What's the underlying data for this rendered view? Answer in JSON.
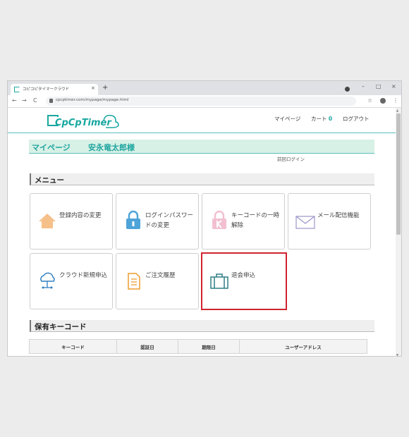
{
  "browser": {
    "tab_title": "コピコピタイマークラウド",
    "tab_close": "×",
    "new_tab": "+",
    "url": "cpcptimer.com/mypage/mypage.html",
    "nav_back": "←",
    "nav_forward": "→",
    "nav_reload": "C",
    "star": "☆",
    "menu": "⋮",
    "win_min": "–",
    "win_max": "□",
    "win_close": "×"
  },
  "header": {
    "logo_text": "CpCpTimer",
    "nav": {
      "mypage": "マイページ",
      "cart_label": "カート",
      "cart_count": "0",
      "logout": "ログアウト"
    }
  },
  "mypage": {
    "title": "マイページ",
    "user": "安永竜太郎様",
    "last_login": "前回ログイン"
  },
  "menu_section": {
    "title": "メニュー",
    "items": [
      {
        "label": "登録内容の変更",
        "icon": "house-icon"
      },
      {
        "label": "ログインパスワードの変更",
        "icon": "lock-icon"
      },
      {
        "label": "キーコードの一時解除",
        "icon": "keycode-lock-icon"
      },
      {
        "label": "メール配信機能",
        "icon": "mail-icon"
      },
      {
        "label": "クラウド新規申込",
        "icon": "cloud-icon"
      },
      {
        "label": "ご注文履歴",
        "icon": "document-icon"
      },
      {
        "label": "退会申込",
        "icon": "briefcase-icon"
      }
    ]
  },
  "keycode_section": {
    "title": "保有キーコード",
    "columns": [
      "キーコード",
      "認証日",
      "期限日",
      "ユーザーアドレス"
    ]
  },
  "colors": {
    "accent": "#1ea5a0",
    "header_bar": "#d8f1e6",
    "active_border": "#d0242f"
  }
}
